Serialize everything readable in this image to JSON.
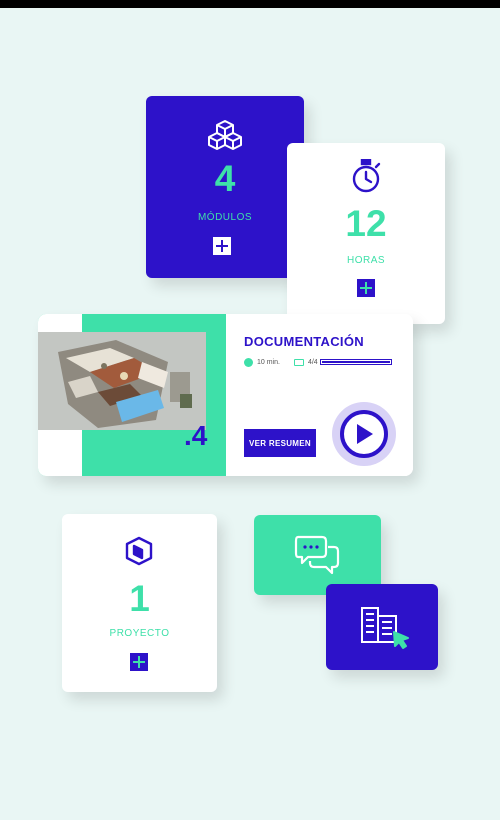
{
  "colors": {
    "primary": "#2d12c9",
    "accent": "#3ee0a9",
    "background": "#e9f6f4"
  },
  "modulos": {
    "number": "4",
    "label": "MÓDULOS",
    "icon": "cubes-icon"
  },
  "horas": {
    "number": "12",
    "label": "HORAS",
    "icon": "stopwatch-icon"
  },
  "documentacion": {
    "title": "DOCUMENTACIÓN",
    "duration": "10 min.",
    "progress_text": "4/4",
    "progress": 1.0,
    "index": ".4",
    "button_label": "VER RESUMEN",
    "icon": "play-icon"
  },
  "proyecto": {
    "number": "1",
    "label": "PROYECTO",
    "icon": "cube-box-icon"
  },
  "chat": {
    "icon": "chat-bubbles-icon"
  },
  "building": {
    "icon": "building-cursor-icon"
  }
}
